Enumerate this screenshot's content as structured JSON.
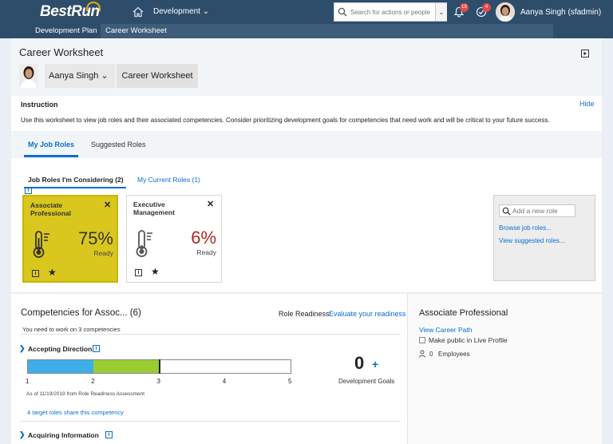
{
  "shell": {
    "logo": "BestRun",
    "nav_menu": "Development ⌄",
    "search_placeholder": "Search for actions or people",
    "notif_badge": "18",
    "tasks_badge": "4",
    "user": "Aanya Singh (sfadmin)"
  },
  "subnav": {
    "plan": "Development Plan",
    "worksheet": "Career Worksheet"
  },
  "header": {
    "title": "Career Worksheet",
    "person_name": "Aanya Singh ⌄",
    "worksheet_button": "Career Worksheet"
  },
  "instruction": {
    "title": "Instruction",
    "hide": "Hide",
    "text": "Use this worksheet to view job roles and their associated competencies. Consider prioritizing development goals for competencies that need work and will be critical to your future success."
  },
  "tabs": {
    "my_roles": "My Job Roles",
    "suggested": "Suggested Roles"
  },
  "subtabs": {
    "considering": "Job Roles I'm Considering (2)",
    "current": "My Current Roles (1)"
  },
  "cards": [
    {
      "title": "Associate Professional",
      "pct": "75%",
      "ready": "Ready",
      "color": "#333333"
    },
    {
      "title": "Executive Management",
      "pct": "6%",
      "ready": "Ready",
      "color": "#b0281f"
    }
  ],
  "add_role": {
    "placeholder": "Add a new role",
    "browse": "Browse job roles...",
    "view_suggested": "View suggested roles..."
  },
  "competencies": {
    "title": "Competencies for Assoc...  (6)",
    "readiness_label": "Role Readiness:",
    "evaluate": "Evaluate your readiness",
    "need": "You need to work on 3 competencies",
    "item1": {
      "name": "Accepting Direction",
      "rated_level": 2,
      "expected_level": 3,
      "scale_max": 5,
      "ticks": [
        "1",
        "2",
        "3",
        "4",
        "5"
      ],
      "as_of": "As of 11/19/2019 from Role Readiness Assessment",
      "target_link": "4 target roles share this competency",
      "goal_count": "0",
      "goal_plus": "+",
      "goal_label": "Development Goals"
    },
    "item2": {
      "name": "Acquiring Information"
    }
  },
  "right_panel": {
    "title": "Associate Professional",
    "career_path": "View Career Path",
    "make_public": "Make public in Live Profile",
    "employee_count": "0",
    "employee_label": "Employees"
  },
  "colors": {
    "shell": "#2e4d6b",
    "accent": "#0a6ed1",
    "card_highlight": "#d9c71d",
    "bar_blue": "#3daee9",
    "bar_green": "#9acd32"
  }
}
